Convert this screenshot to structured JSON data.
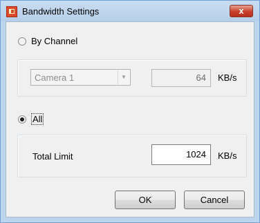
{
  "window": {
    "title": "Bandwidth Settings",
    "close_glyph": "x"
  },
  "by_channel": {
    "label": "By Channel",
    "selected": false,
    "camera_select": {
      "value": "Camera 1",
      "enabled": false
    },
    "bandwidth_value": "64",
    "unit": "KB/s"
  },
  "all": {
    "label": "All",
    "selected": true,
    "total_limit_label": "Total Limit",
    "total_limit_value": "1024",
    "unit": "KB/s"
  },
  "buttons": {
    "ok": "OK",
    "cancel": "Cancel"
  },
  "icons": {
    "app": "app-icon",
    "close": "close-icon",
    "dropdown": "chevron-down-icon"
  }
}
